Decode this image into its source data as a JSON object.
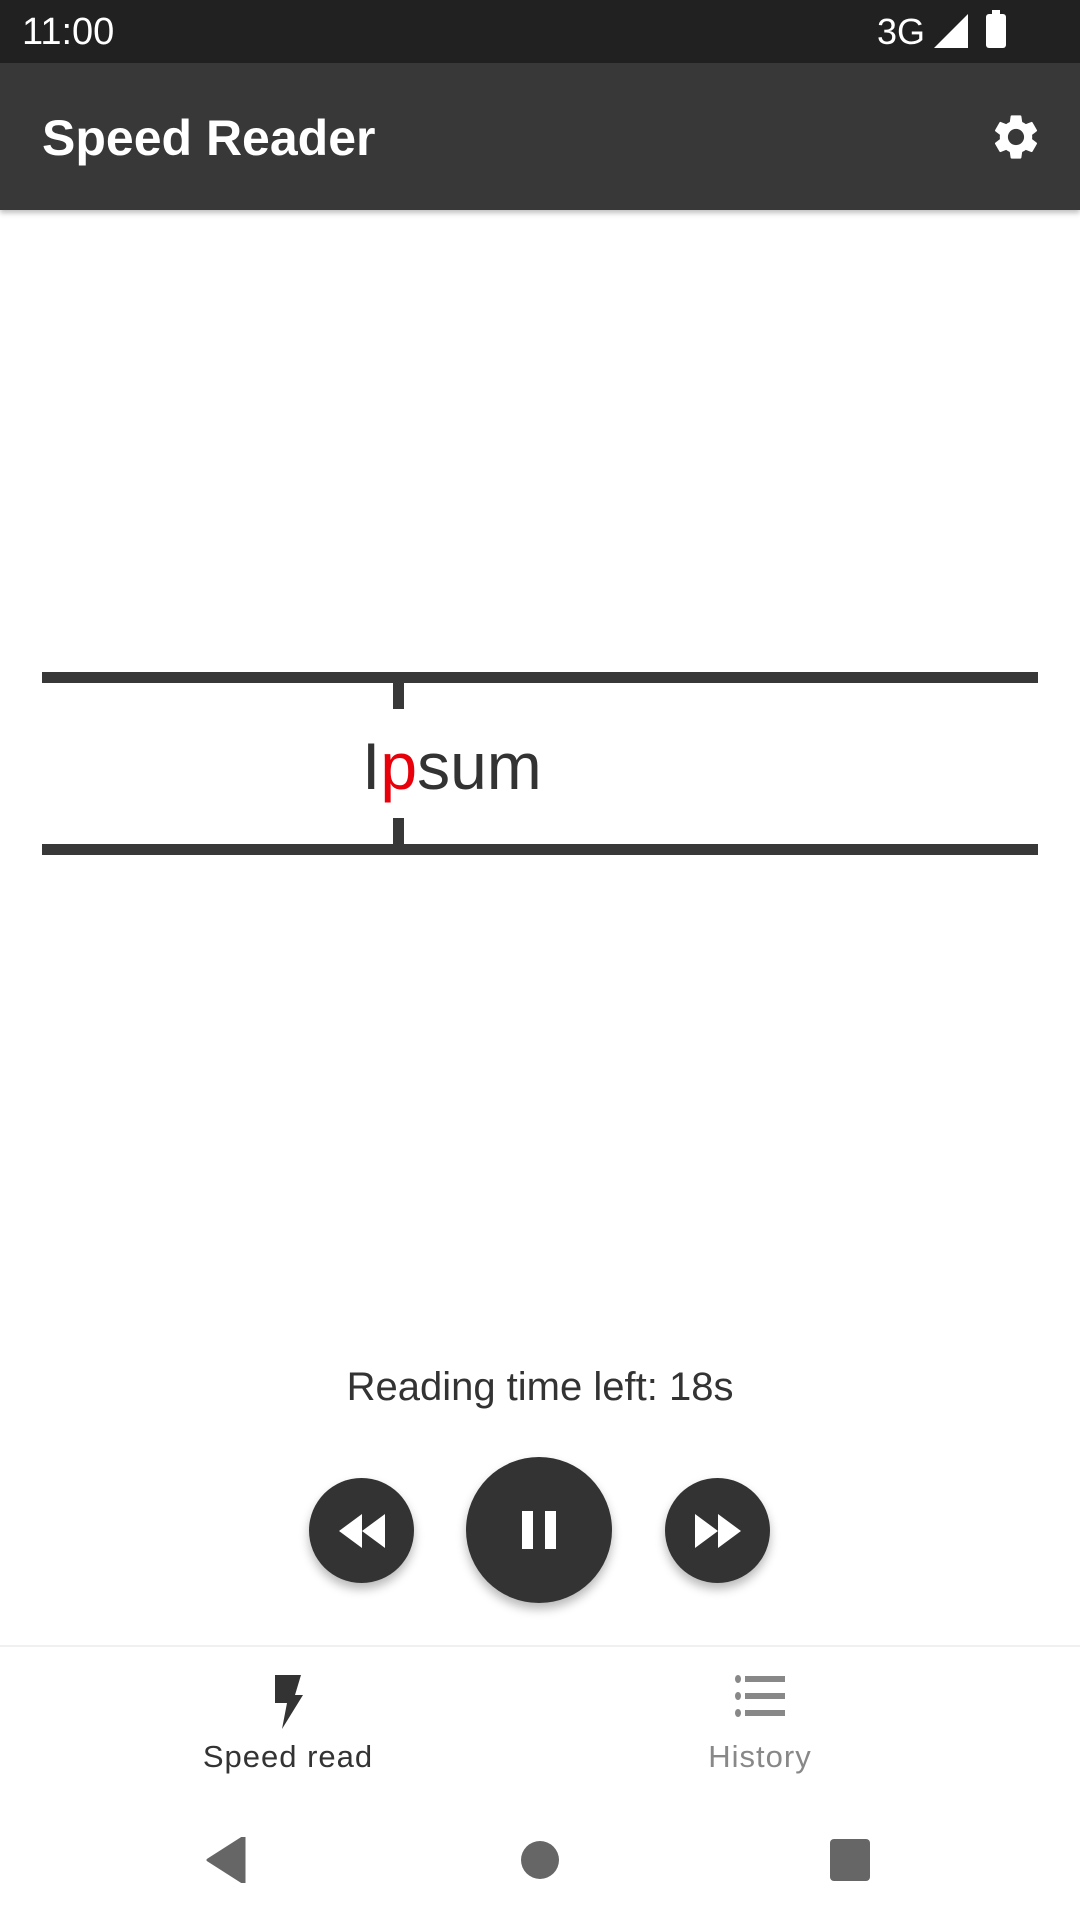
{
  "status_bar": {
    "time": "11:00",
    "network": "3G",
    "signal_icon": "cell-signal-icon",
    "battery_icon": "battery-icon"
  },
  "app_bar": {
    "title": "Speed Reader",
    "settings_icon": "gear-icon"
  },
  "reader": {
    "word_before_focus": "I",
    "focus_letter": "p",
    "word_after_focus": "sum",
    "focus_color": "#e8000b"
  },
  "playback": {
    "time_left_label": "Reading time left: 18s",
    "rewind_icon": "rewind-icon",
    "pause_icon": "pause-icon",
    "forward_icon": "fast-forward-icon"
  },
  "bottom_nav": {
    "items": [
      {
        "label": "Speed read",
        "icon": "lightning-bolt-icon",
        "active": true
      },
      {
        "label": "History",
        "icon": "list-icon",
        "active": false
      }
    ]
  },
  "system_nav": {
    "back": "back-icon",
    "home": "home-icon",
    "recents": "recents-icon"
  }
}
